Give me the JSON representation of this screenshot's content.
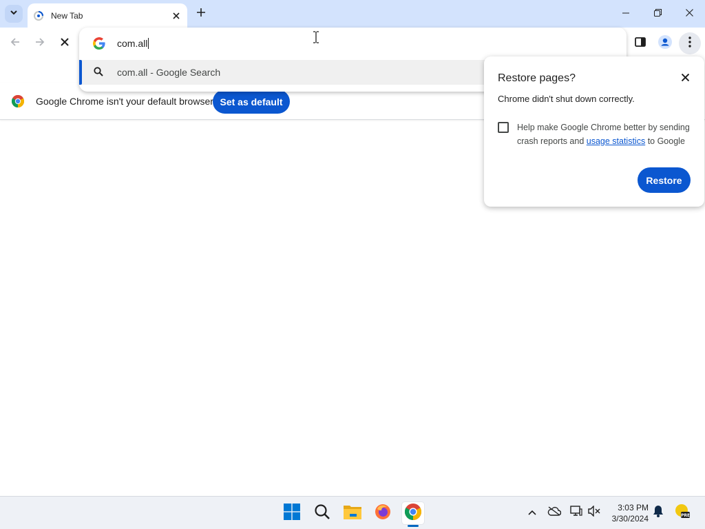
{
  "colors": {
    "accent": "#0b57d0",
    "titlebar": "#d3e3fd",
    "taskbar": "#eef1f6"
  },
  "tab": {
    "title": "New Tab",
    "favicon": "loading-spinner-icon"
  },
  "omnibox": {
    "value": "com.all",
    "suggestion": "com.all - Google Search"
  },
  "infobar": {
    "message": "Google Chrome isn't your default browser",
    "button": "Set as default"
  },
  "restore": {
    "title": "Restore pages?",
    "body": "Chrome didn't shut down correctly.",
    "checkbox_prefix": "Help make Google Chrome better by sending crash reports and ",
    "checkbox_link": "usage statistics",
    "checkbox_suffix": " to Google",
    "checkbox_checked": false,
    "button": "Restore"
  },
  "taskbar": {
    "time": "3:03 PM",
    "date": "3/30/2024",
    "apps": [
      "windows-start-icon",
      "search-icon",
      "file-explorer-icon",
      "firefox-icon",
      "chrome-icon"
    ]
  }
}
